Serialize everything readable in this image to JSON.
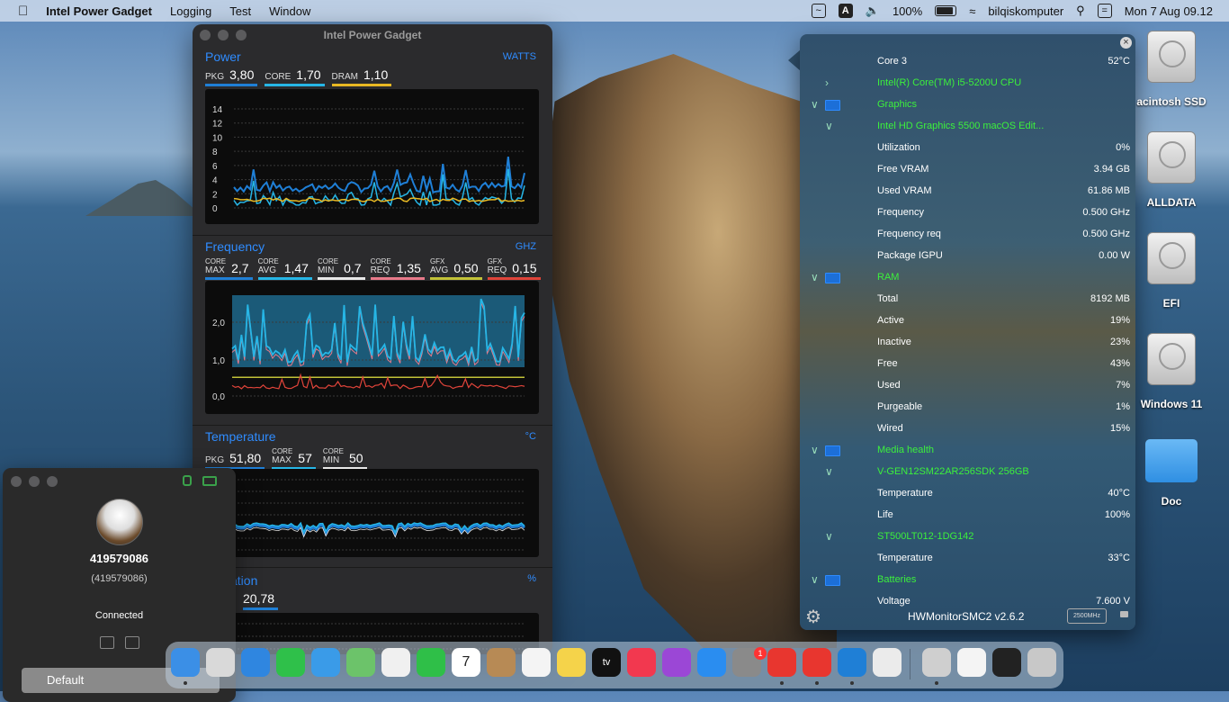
{
  "menubar": {
    "app": "Intel Power Gadget",
    "items": [
      "Logging",
      "Test",
      "Window"
    ],
    "battery": "100%",
    "user": "bilqiskomputer",
    "datetime": "Mon 7 Aug  09.12"
  },
  "ipg": {
    "title": "Intel Power Gadget",
    "power": {
      "title": "Power",
      "unit": "WATTS",
      "metrics": [
        {
          "label": "PKG",
          "value": "3,80",
          "color": "#1f7fd6"
        },
        {
          "label": "CORE",
          "value": "1,70",
          "color": "#26b6e6"
        },
        {
          "label": "DRAM",
          "value": "1,10",
          "color": "#e8b823"
        }
      ],
      "yticks": [
        "14",
        "12",
        "10",
        "8",
        "6",
        "4",
        "2",
        "0"
      ]
    },
    "frequency": {
      "title": "Frequency",
      "unit": "GHZ",
      "metrics": [
        {
          "l1": "CORE",
          "l2": "MAX",
          "value": "2,7",
          "color": "#1f7fd6"
        },
        {
          "l1": "CORE",
          "l2": "AVG",
          "value": "1,47",
          "color": "#26b6e6"
        },
        {
          "l1": "CORE",
          "l2": "MIN",
          "value": "0,7",
          "color": "#e8e8e8"
        },
        {
          "l1": "CORE",
          "l2": "REQ",
          "value": "1,35",
          "color": "#e87a8a"
        },
        {
          "l1": "GFX",
          "l2": "AVG",
          "value": "0,50",
          "color": "#c2c238"
        },
        {
          "l1": "GFX",
          "l2": "REQ",
          "value": "0,15",
          "color": "#e0443a"
        }
      ],
      "yticks": [
        "2,0",
        "1,0",
        "0,0"
      ]
    },
    "temperature": {
      "title": "Temperature",
      "unit": "°C",
      "metrics": [
        {
          "l1": "",
          "l2": "PKG",
          "value": "51,80",
          "color": "#1f7fd6"
        },
        {
          "l1": "CORE",
          "l2": "MAX",
          "value": "57",
          "color": "#26b6e6"
        },
        {
          "l1": "CORE",
          "l2": "MIN",
          "value": "50",
          "color": "#e8e8e8"
        }
      ]
    },
    "utilization": {
      "title": "ation",
      "unit": "%",
      "metrics": [
        {
          "label": "",
          "value": "20,78",
          "color": "#1f7fd6"
        }
      ]
    }
  },
  "hw": {
    "rows": [
      {
        "name": "Core 3",
        "value": "52°C",
        "green": false,
        "kind": "item"
      },
      {
        "name": "Intel(R) Core(TM) i5-5200U CPU",
        "value": "",
        "green": true,
        "kind": "collapsed"
      },
      {
        "name": "Graphics",
        "value": "",
        "green": true,
        "kind": "group"
      },
      {
        "name": "Intel HD Graphics 5500 macOS Edit...",
        "value": "",
        "green": true,
        "kind": "sub"
      },
      {
        "name": "Utilization",
        "value": "0%",
        "green": false,
        "kind": "item"
      },
      {
        "name": "Free VRAM",
        "value": "3.94 GB",
        "green": false,
        "kind": "item"
      },
      {
        "name": "Used VRAM",
        "value": "61.86 MB",
        "green": false,
        "kind": "item"
      },
      {
        "name": "Frequency",
        "value": "0.500 GHz",
        "green": false,
        "kind": "item"
      },
      {
        "name": "Frequency req",
        "value": "0.500 GHz",
        "green": false,
        "kind": "item"
      },
      {
        "name": "Package IGPU",
        "value": "0.00 W",
        "green": false,
        "kind": "item"
      },
      {
        "name": "RAM",
        "value": "",
        "green": true,
        "kind": "group"
      },
      {
        "name": "Total",
        "value": "8192 MB",
        "green": false,
        "kind": "item"
      },
      {
        "name": "Active",
        "value": "19%",
        "green": false,
        "kind": "item"
      },
      {
        "name": "Inactive",
        "value": "23%",
        "green": false,
        "kind": "item"
      },
      {
        "name": "Free",
        "value": "43%",
        "green": false,
        "kind": "item"
      },
      {
        "name": "Used",
        "value": "7%",
        "green": false,
        "kind": "item"
      },
      {
        "name": "Purgeable",
        "value": "1%",
        "green": false,
        "kind": "item"
      },
      {
        "name": "Wired",
        "value": "15%",
        "green": false,
        "kind": "item"
      },
      {
        "name": "Media health",
        "value": "",
        "green": true,
        "kind": "group"
      },
      {
        "name": "V-GEN12SM22AR256SDK 256GB",
        "value": "",
        "green": true,
        "kind": "sub"
      },
      {
        "name": "Temperature",
        "value": "40°C",
        "green": false,
        "kind": "item"
      },
      {
        "name": "Life",
        "value": "100%",
        "green": false,
        "kind": "item"
      },
      {
        "name": "ST500LT012-1DG142",
        "value": "",
        "green": true,
        "kind": "sub"
      },
      {
        "name": "Temperature",
        "value": "33°C",
        "green": false,
        "kind": "item"
      },
      {
        "name": "Batteries",
        "value": "",
        "green": true,
        "kind": "group"
      },
      {
        "name": "Voltage",
        "value": "7.600 V",
        "green": false,
        "kind": "item"
      }
    ],
    "version": "HWMonitorSMC2 v2.6.2",
    "mhz": "2500MHz"
  },
  "desktop": {
    "icons": [
      "acintosh SSD",
      "ALLDATA",
      "EFI",
      "Windows 11",
      "Doc"
    ]
  },
  "teamviewer": {
    "id": "419579086",
    "sub": "(419579086)",
    "status": "Connected",
    "button": "Default"
  },
  "dock": {
    "apps": [
      {
        "name": "finder",
        "color": "#3b8fe6",
        "dot": true
      },
      {
        "name": "launchpad",
        "color": "#d9d9d9",
        "dot": false
      },
      {
        "name": "safari",
        "color": "#2f86e0",
        "dot": false
      },
      {
        "name": "messages",
        "color": "#2fc04a",
        "dot": false
      },
      {
        "name": "mail",
        "color": "#3a9be8",
        "dot": false
      },
      {
        "name": "maps",
        "color": "#6cc36a",
        "dot": false
      },
      {
        "name": "photos",
        "color": "#f0f0f0",
        "dot": false
      },
      {
        "name": "facetime",
        "color": "#2fbf48",
        "dot": false
      },
      {
        "name": "calendar",
        "color": "#ffffff",
        "dot": false,
        "text": "7"
      },
      {
        "name": "contacts",
        "color": "#b78a55",
        "dot": false
      },
      {
        "name": "reminders",
        "color": "#f4f4f4",
        "dot": false
      },
      {
        "name": "notes",
        "color": "#f5d34a",
        "dot": false
      },
      {
        "name": "tv",
        "color": "#111111",
        "dot": false,
        "text": "tv"
      },
      {
        "name": "music",
        "color": "#f2384f",
        "dot": false
      },
      {
        "name": "podcasts",
        "color": "#9b47d6",
        "dot": false
      },
      {
        "name": "app-store",
        "color": "#2a8df0",
        "dot": false
      },
      {
        "name": "system-preferences",
        "color": "#8a8a8a",
        "dot": false
      },
      {
        "name": "anydesk-red",
        "color": "#e8362f",
        "dot": true
      },
      {
        "name": "anydesk-tool",
        "color": "#e8362f",
        "dot": true
      },
      {
        "name": "intel-power-gadget",
        "color": "#1f7fd6",
        "dot": true
      },
      {
        "name": "textedit",
        "color": "#ebebeb",
        "dot": false
      },
      {
        "name": "hw-monitor",
        "color": "#cfcfcf",
        "dot": true
      },
      {
        "name": "document",
        "color": "#f4f4f4",
        "dot": false
      },
      {
        "name": "screenshot",
        "color": "#222222",
        "dot": false
      },
      {
        "name": "trash",
        "color": "#c8c8c8",
        "dot": false
      }
    ],
    "badge": "1"
  }
}
